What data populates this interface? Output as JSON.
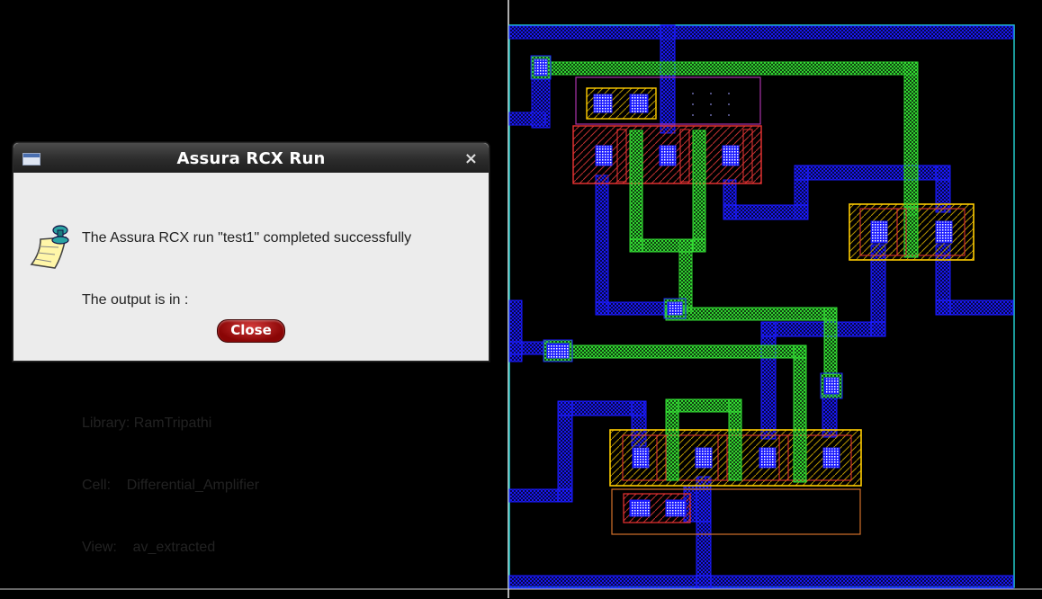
{
  "dialog": {
    "title": "Assura RCX Run",
    "close_glyph": "×",
    "lines": [
      "The Assura RCX run \"test1\" completed successfully",
      "The output is in :",
      "Library: RamTripathi",
      "Cell:    Differential_Amplifier",
      "View:    av_extracted"
    ],
    "close_label": "Close",
    "icon": "note-pin-icon"
  },
  "layout_view": {
    "background": "#000000",
    "colors": {
      "metal1": "#1a1aff",
      "metal2": "#33dd33",
      "poly": "#ee3333",
      "diffusion": "#ffcc00",
      "nwell": "#d28a2a",
      "prboundary": "#aa33aa",
      "boundary": "#22cccc",
      "contact": "#ffffff"
    }
  }
}
